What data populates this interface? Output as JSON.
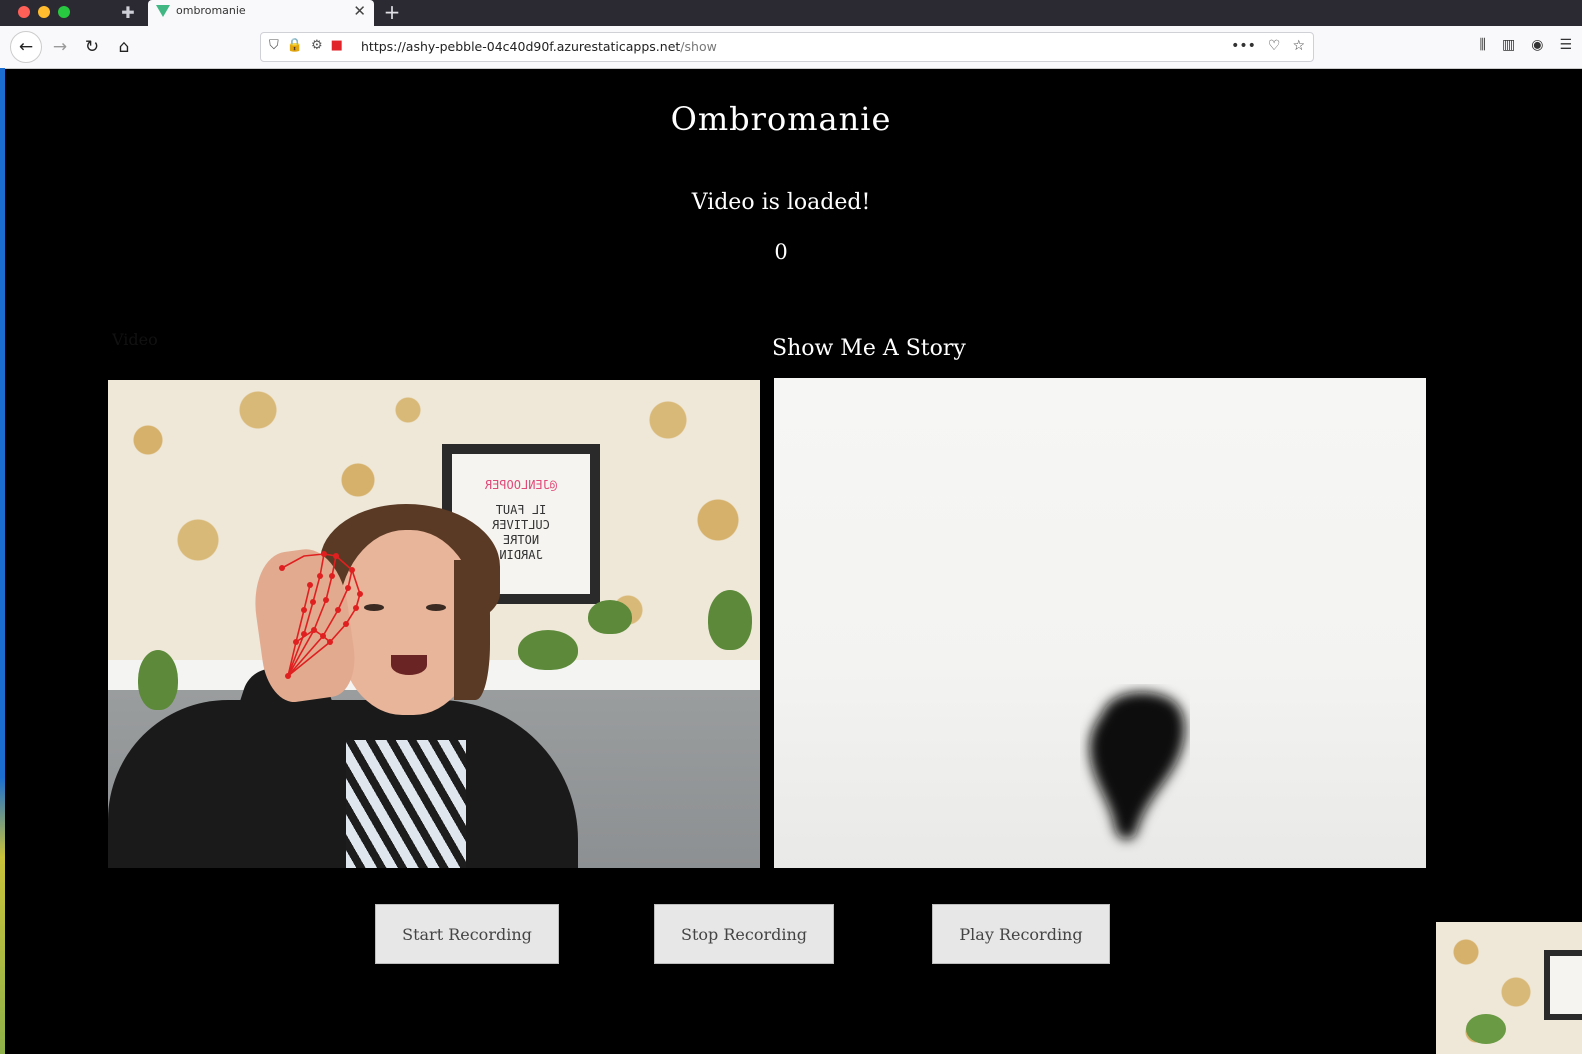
{
  "browser": {
    "tab_title": "ombromanie",
    "tab_close": "✕",
    "new_tab": "+",
    "url_host": "https://ashy-pebble-04c40d90f.azurestaticapps.net",
    "url_path": "/show",
    "nav_icons": {
      "back": "←",
      "forward": "→",
      "reload": "↻",
      "home": "⌂"
    },
    "url_icons": {
      "shield": "⛉",
      "lock": "🔒",
      "permissions": "⚙",
      "camera": "■"
    },
    "url_actions": {
      "more": "•••",
      "pocket": "♡",
      "bookmark": "☆"
    },
    "toolbar_icons": {
      "library": "⫼",
      "sidebar": "▥",
      "account": "◉",
      "menu": "☰"
    }
  },
  "page": {
    "title": "Ombromanie",
    "status": "Video is loaded!",
    "counter": "0",
    "video_label": "Video",
    "story_title": "Show Me A Story"
  },
  "letterboard": {
    "line1": "@JENLOOPER",
    "line2": "IL FAUT",
    "line3": "CULTIVER",
    "line4": "NOTRE",
    "line5": "JARDIN"
  },
  "controls": {
    "start": "Start Recording",
    "stop": "Stop Recording",
    "play": "Play Recording"
  },
  "colors": {
    "page_background": "#000000",
    "landmark_red": "#e02020",
    "button_background": "#e7e7e7"
  }
}
